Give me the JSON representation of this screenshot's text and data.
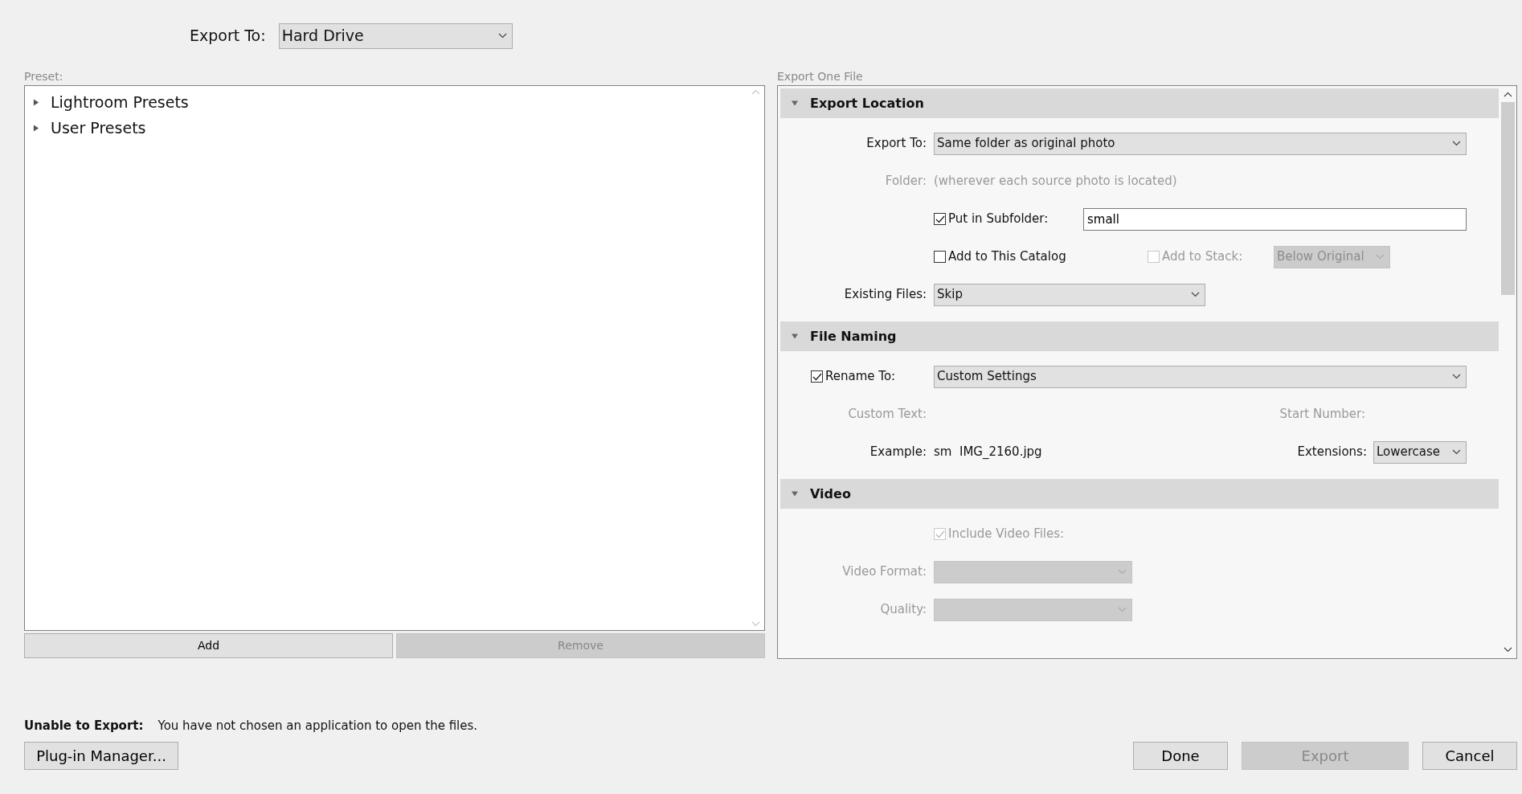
{
  "export_to": {
    "label": "Export To:",
    "value": "Hard Drive"
  },
  "preset": {
    "label": "Preset:",
    "items": [
      {
        "label": "Lightroom Presets",
        "expanded": false
      },
      {
        "label": "User Presets",
        "expanded": false
      }
    ],
    "buttons": [
      {
        "label": "Add",
        "disabled": false
      },
      {
        "label": "Remove",
        "disabled": true
      }
    ]
  },
  "settings": {
    "title": "Export One File",
    "sections": [
      {
        "title": "Export Location",
        "expanded": true,
        "rows": [
          {
            "kind": "wideselect",
            "label": "Export To:",
            "value": "Same folder as original photo",
            "disabled": false
          },
          {
            "kind": "info",
            "label": "Folder:",
            "value": "(wherever each source photo is located)",
            "disabled": true
          },
          {
            "kind": "checkinput",
            "label": "Put in Subfolder:",
            "checked": true,
            "value": "small"
          },
          {
            "kind": "checkpair",
            "first": {
              "label": "Add to This Catalog",
              "checked": false,
              "disabled": false
            },
            "second": {
              "label": "Add to Stack:",
              "checked": false,
              "disabled": true
            },
            "select": {
              "value": "Below Original",
              "disabled": true
            }
          },
          {
            "kind": "select",
            "label": "Existing Files:",
            "value": "Skip",
            "disabled": false
          }
        ]
      },
      {
        "title": "File Naming",
        "expanded": true,
        "rows": [
          {
            "kind": "checkselect",
            "label": "Rename To:",
            "checked": true,
            "value": "Custom Settings"
          },
          {
            "kind": "labels",
            "label": "Custom Text:",
            "right_label": "Start Number:",
            "disabled": true
          },
          {
            "kind": "example",
            "label": "Example:",
            "value": "sm  IMG_2160.jpg",
            "right_label": "Extensions:",
            "right_value": "Lowercase"
          }
        ]
      },
      {
        "title": "Video",
        "expanded": true,
        "rows": [
          {
            "kind": "check",
            "label": "Include Video Files:",
            "checked": true,
            "disabled": true
          },
          {
            "kind": "smallselect",
            "label": "Video Format:",
            "disabled": true
          },
          {
            "kind": "smallselect",
            "label": "Quality:",
            "disabled": true
          }
        ]
      }
    ]
  },
  "status": {
    "label": "Unable to Export:",
    "message": "You have not chosen an application to open the files."
  },
  "buttons": [
    {
      "label": "Plug-in Manager...",
      "disabled": false
    },
    {
      "label": "Done",
      "disabled": false
    },
    {
      "label": "Export",
      "disabled": true
    },
    {
      "label": "Cancel",
      "disabled": false
    }
  ]
}
